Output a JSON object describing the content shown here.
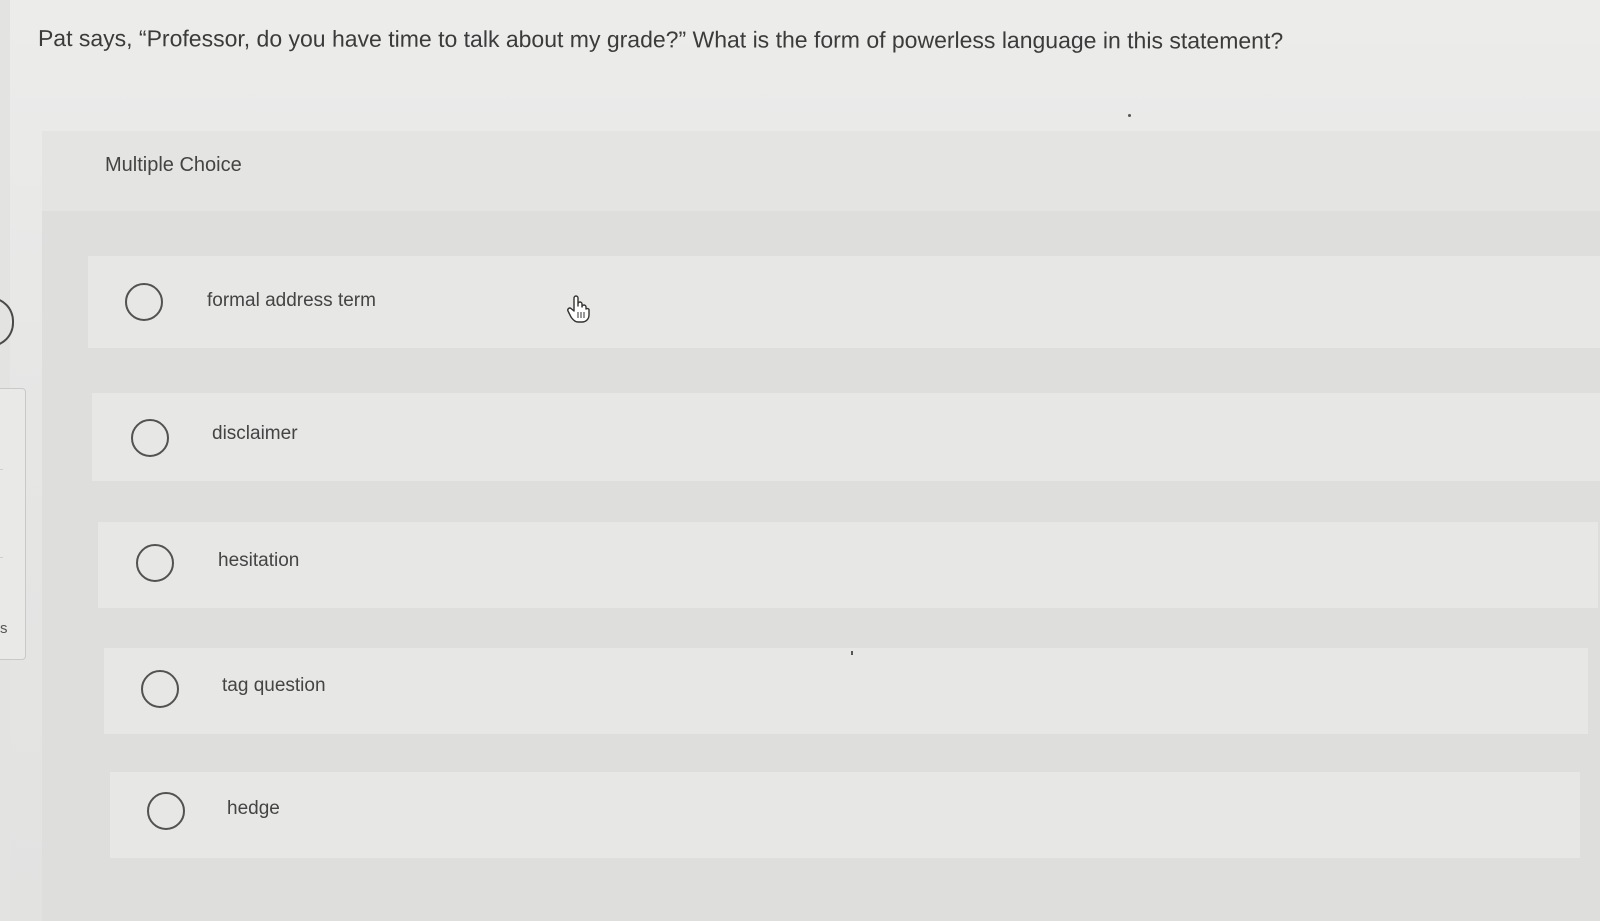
{
  "question": {
    "text": "Pat says, “Professor, do you have time to talk about my grade?” What is the form of powerless language in this statement?"
  },
  "multiple_choice": {
    "label": "Multiple Choice",
    "options": [
      {
        "label": "formal address term"
      },
      {
        "label": "disclaimer"
      },
      {
        "label": "hesitation"
      },
      {
        "label": "tag question"
      },
      {
        "label": "hedge"
      }
    ]
  },
  "sidebar": {
    "fragment_text": "s"
  },
  "icons": {
    "radio": "radio-unselected-icon",
    "cursor": "hand-pointer-icon"
  },
  "colors": {
    "background": "#e7e7e6",
    "panel": "#dededd",
    "option_card": "#e7e7e6",
    "text": "#3b3b3b"
  }
}
